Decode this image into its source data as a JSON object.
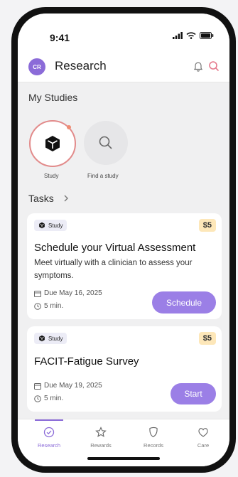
{
  "status": {
    "time": "9:41"
  },
  "app": {
    "title": "Research",
    "avatar_initials": "CR"
  },
  "my_studies": {
    "heading": "My Studies",
    "items": [
      {
        "label": "Study",
        "icon": "cube-icon"
      },
      {
        "label": "Find a study",
        "icon": "search-icon"
      }
    ]
  },
  "tasks": {
    "heading": "Tasks",
    "cards": [
      {
        "badge": "Study",
        "price": "$5",
        "title": "Schedule your Virtual Assessment",
        "description": "Meet virtually with a clinician to assess your symptoms.",
        "due": "Due May 16, 2025",
        "duration": "5 min.",
        "action": "Schedule"
      },
      {
        "badge": "Study",
        "price": "$5",
        "title": "FACIT-Fatigue Survey",
        "description": "",
        "due": "Due May 19, 2025",
        "duration": "5 min.",
        "action": "Start"
      }
    ]
  },
  "tabbar": {
    "items": [
      {
        "label": "Research",
        "icon": "check-circle-icon",
        "active": true
      },
      {
        "label": "Rewards",
        "icon": "star-icon",
        "active": false
      },
      {
        "label": "Records",
        "icon": "shield-icon",
        "active": false
      },
      {
        "label": "Care",
        "icon": "heart-icon",
        "active": false
      }
    ]
  },
  "colors": {
    "accent": "#9b7fe6",
    "price_bg": "#fde7b9",
    "study_ring": "#e28b8b"
  }
}
